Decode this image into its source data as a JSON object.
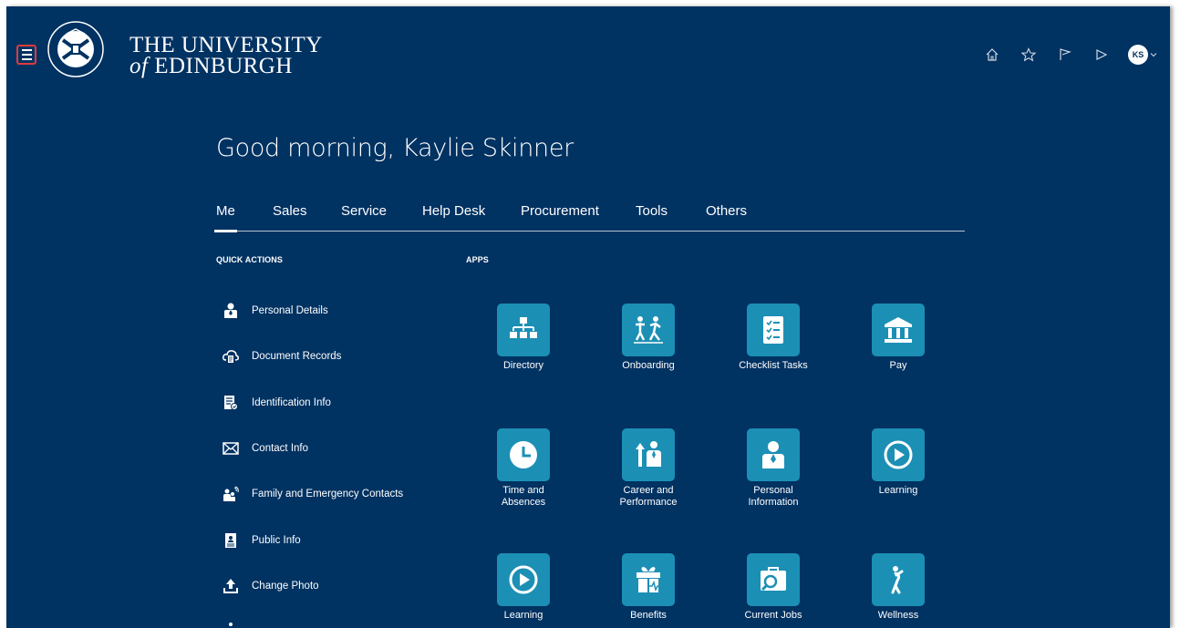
{
  "header": {
    "university_line1": "THE UNIVERSITY",
    "university_line2_of": "of",
    "university_line2_rest": " EDINBURGH",
    "avatar_initials": "KS"
  },
  "greeting": "Good morning, Kaylie Skinner",
  "tabs": [
    {
      "label": "Me"
    },
    {
      "label": "Sales"
    },
    {
      "label": "Service"
    },
    {
      "label": "Help Desk"
    },
    {
      "label": "Procurement"
    },
    {
      "label": "Tools"
    },
    {
      "label": "Others"
    }
  ],
  "quick_actions": {
    "title": "QUICK ACTIONS",
    "items": [
      {
        "label": "Personal Details",
        "icon": "person-icon"
      },
      {
        "label": "Document Records",
        "icon": "document-cloud-icon"
      },
      {
        "label": "Identification Info",
        "icon": "id-document-icon"
      },
      {
        "label": "Contact Info",
        "icon": "envelope-icon"
      },
      {
        "label": "Family and Emergency Contacts",
        "icon": "family-icon"
      },
      {
        "label": "Public Info",
        "icon": "badge-icon"
      },
      {
        "label": "Change Photo",
        "icon": "upload-icon"
      }
    ]
  },
  "apps": {
    "title": "APPS",
    "items": [
      {
        "label": "Directory",
        "icon": "org-chart-icon"
      },
      {
        "label": "Onboarding",
        "icon": "onboarding-icon"
      },
      {
        "label": "Checklist Tasks",
        "icon": "checklist-icon"
      },
      {
        "label": "Pay",
        "icon": "bank-icon"
      },
      {
        "label": "Time and\nAbsences",
        "icon": "clock-icon"
      },
      {
        "label": "Career and\nPerformance",
        "icon": "career-icon"
      },
      {
        "label": "Personal\nInformation",
        "icon": "person-icon"
      },
      {
        "label": "Learning",
        "icon": "play-circle-icon"
      },
      {
        "label": "Learning",
        "icon": "play-circle-icon"
      },
      {
        "label": "Benefits",
        "icon": "gift-icon"
      },
      {
        "label": "Current Jobs",
        "icon": "job-search-icon"
      },
      {
        "label": "Wellness",
        "icon": "wellness-icon"
      }
    ]
  }
}
